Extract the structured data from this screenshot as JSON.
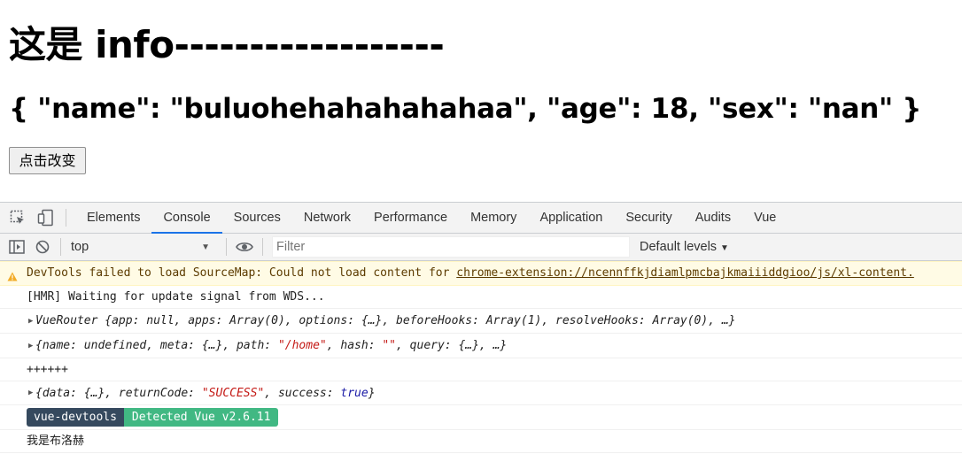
{
  "page": {
    "heading": "这是 info------------------",
    "json_text": "{ \"name\": \"buluohehahahahahaa\", \"age\": 18, \"sex\": \"nan\" }",
    "button_label": "点击改变"
  },
  "devtools": {
    "tabs": [
      "Elements",
      "Console",
      "Sources",
      "Network",
      "Performance",
      "Memory",
      "Application",
      "Security",
      "Audits",
      "Vue"
    ],
    "active_tab": "Console",
    "context": "top",
    "filter_placeholder": "Filter",
    "levels": "Default levels",
    "console": {
      "warning_prefix": "DevTools failed to load SourceMap: Could not load content for ",
      "warning_link": "chrome-extension://ncennffkjdiamlpmcbajkmaiiiddgioo/js/xl-content.",
      "hmr": "[HMR] Waiting for update signal from WDS...",
      "router_name": "VueRouter",
      "router_rest": " {app: null, apps: Array(0), options: {…}, beforeHooks: Array(1), resolveHooks: Array(0), …}",
      "route_a": "{name: undefined, meta: {…}, path: ",
      "route_path": "\"/home\"",
      "route_b": ", hash: ",
      "route_hash": "\"\"",
      "route_c": ", query: {…}, …}",
      "plus": "++++++",
      "resp_a": "{data: {…}, returnCode: ",
      "resp_code": "\"SUCCESS\"",
      "resp_b": ", success: ",
      "resp_true": "true",
      "resp_c": "}",
      "badge_left": "vue-devtools",
      "badge_right": "Detected Vue v2.6.11",
      "last": "我是布洛赫"
    }
  },
  "colors": {
    "accent": "#1a73e8",
    "vue_dark": "#35495e",
    "vue_green": "#41b883",
    "warning_bg": "#fffbe5"
  }
}
